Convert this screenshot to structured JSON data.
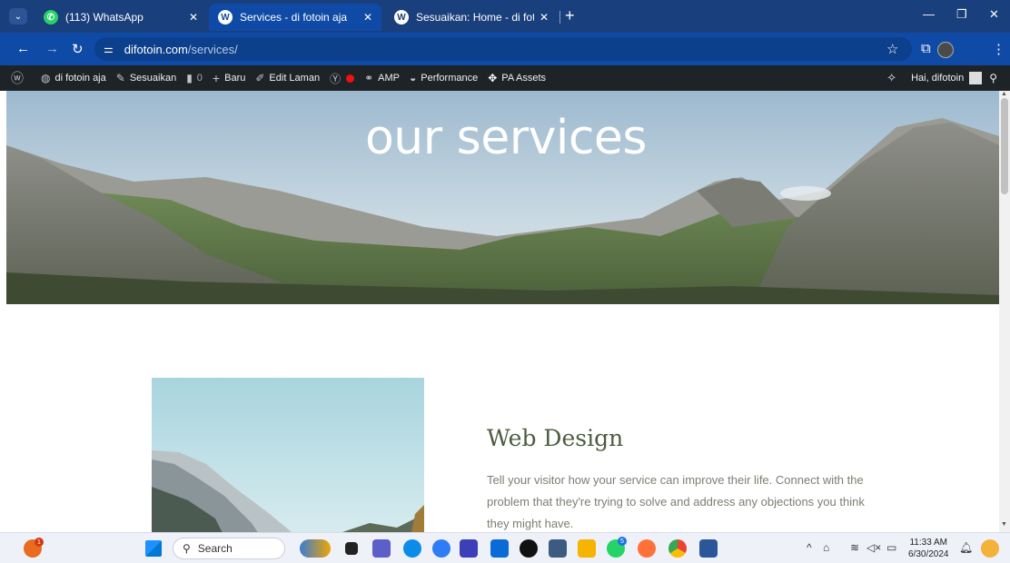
{
  "browser": {
    "tabs": [
      {
        "title": "(113) WhatsApp",
        "icon": "whatsapp-icon",
        "active": false
      },
      {
        "title": "Services - di fotoin aja",
        "icon": "wordpress-icon",
        "active": true
      },
      {
        "title": "Sesuaikan: Home - di fotoin aja",
        "icon": "wordpress-icon",
        "active": false
      }
    ],
    "url_domain": "difotoin.com",
    "url_path": "/services/"
  },
  "adminbar": {
    "site_name": "di fotoin aja",
    "customize": "Sesuaikan",
    "comments_count": "0",
    "new": "Baru",
    "edit_page": "Edit Laman",
    "amp": "AMP",
    "performance": "Performance",
    "pa_assets": "PA Assets",
    "greeting": "Hai, difotoin"
  },
  "hero": {
    "title": "our services"
  },
  "service": {
    "title": "Web Design",
    "description": "Tell your visitor how your service can improve their life. Connect with the problem that they're trying to solve and address any objections you think they might have."
  },
  "taskbar": {
    "search_placeholder": "Search",
    "time": "11:33 AM",
    "date": "6/30/2024",
    "notification_badge": "1",
    "whatsapp_badge": "5"
  },
  "colors": {
    "tabstrip": "#1a3f7d",
    "toolbar": "#0f4ba6",
    "adminbar": "#1d2327",
    "service_title": "#4d5b3f",
    "service_text": "#7a7f73"
  }
}
